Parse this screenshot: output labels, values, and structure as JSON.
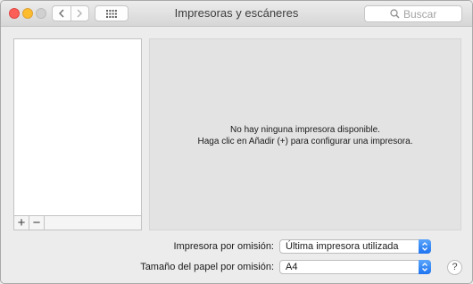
{
  "window": {
    "title": "Impresoras y escáneres"
  },
  "search": {
    "placeholder": "Buscar"
  },
  "printers": {
    "add_label": "+",
    "remove_label": "−"
  },
  "detail": {
    "line1": "No hay ninguna impresora disponible.",
    "line2": "Haga clic en Añadir (+) para configurar una impresora."
  },
  "settings": {
    "default_printer_label": "Impresora por omisión:",
    "default_printer_value": "Última impresora utilizada",
    "paper_size_label": "Tamaño del papel por omisión:",
    "paper_size_value": "A4"
  },
  "help": {
    "label": "?"
  },
  "icons": {
    "close": "close-icon",
    "minimize": "minimize-icon",
    "zoom": "zoom-icon",
    "back": "chevron-left-icon",
    "forward": "chevron-right-icon",
    "show_all": "grid-icon",
    "search": "search-icon",
    "stepper": "stepper-icon"
  },
  "colors": {
    "accent": "#1f74f0",
    "close": "#fc5f57",
    "minimize": "#fdbc2e"
  }
}
